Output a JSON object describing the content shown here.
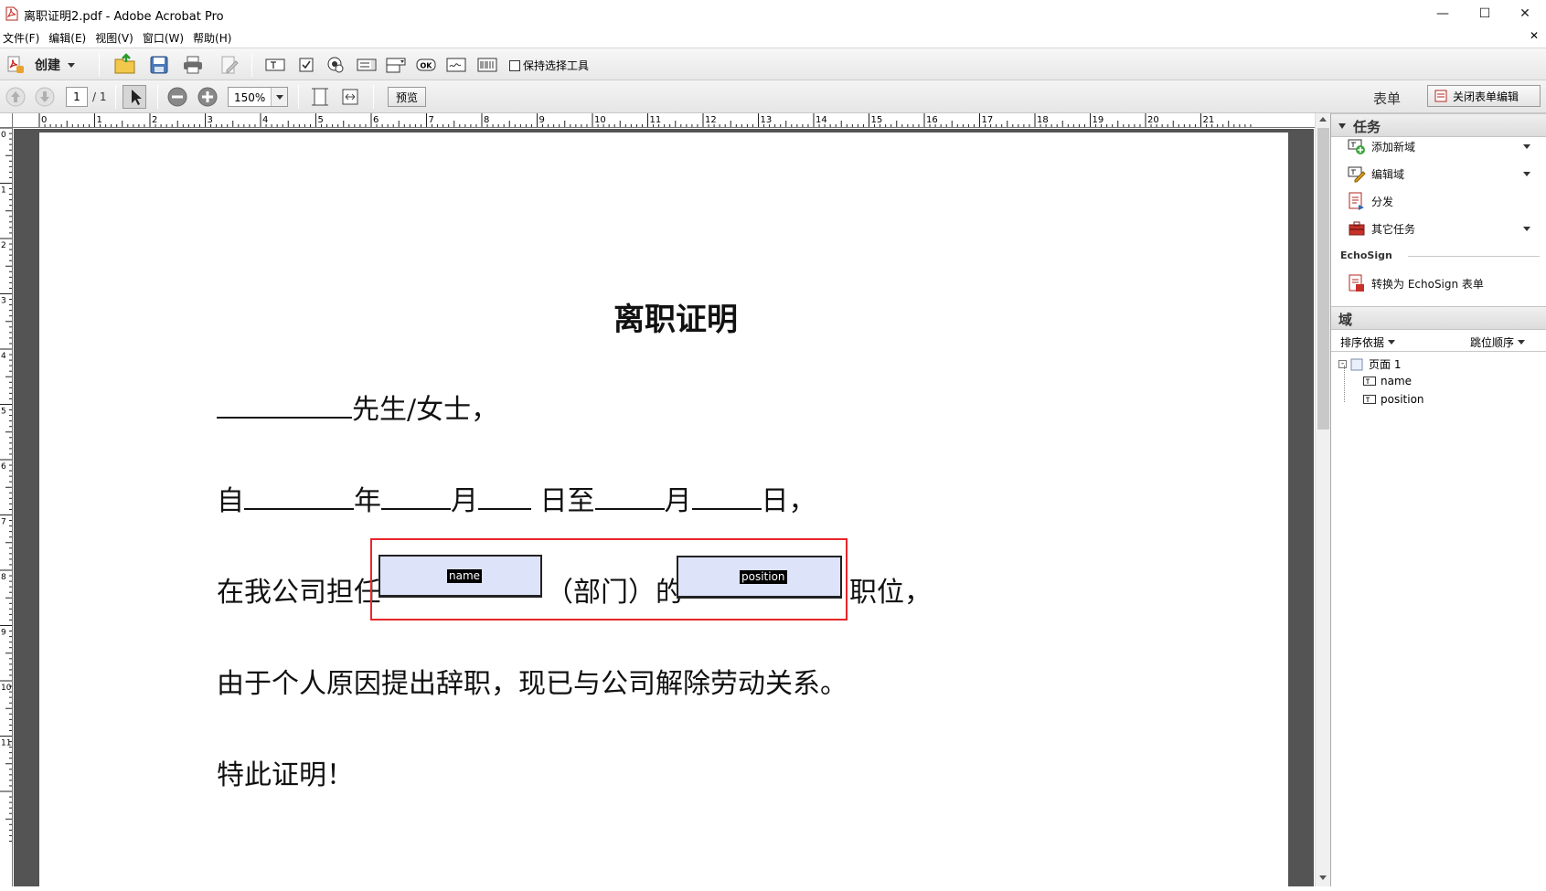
{
  "window": {
    "title": "离职证明2.pdf - Adobe Acrobat Pro",
    "minimize": "—",
    "maximize": "☐",
    "close": "✕"
  },
  "menu": {
    "items": [
      "文件(F)",
      "编辑(E)",
      "视图(V)",
      "窗口(W)",
      "帮助(H)"
    ],
    "close_doc": "✕"
  },
  "toolbar1": {
    "create_label": "创建",
    "keep_tool_label": "保持选择工具"
  },
  "toolbar2": {
    "page_current": "1",
    "page_total": "/ 1",
    "zoom": "150%",
    "preview_label": "预览",
    "form_label": "表单",
    "close_form_label": "关闭表单编辑"
  },
  "ruler": {
    "top_marks": [
      "0",
      "1",
      "2",
      "3",
      "4",
      "5",
      "6",
      "7",
      "8",
      "9",
      "10",
      "11",
      "12",
      "13",
      "14",
      "15",
      "16",
      "17",
      "18",
      "19",
      "20",
      "21"
    ],
    "left_marks": [
      "0",
      "1",
      "2",
      "3",
      "4",
      "5",
      "6",
      "7",
      "8",
      "9",
      "10",
      "11"
    ]
  },
  "document": {
    "title": "离职证明",
    "line1_suffix": "先生/女士，",
    "line2": {
      "p1": "自",
      "p2": "年",
      "p3": "月",
      "p4": " 日至",
      "p5": "月",
      "p6": "日，"
    },
    "line3": {
      "prefix": "在我公司担任",
      "middle": "（部门）的",
      "suffix": "职位，"
    },
    "line4": "由于个人原因提出辞职，现已与公司解除劳动关系。",
    "line5": "特此证明！",
    "fields": [
      {
        "name": "name"
      },
      {
        "name": "position"
      }
    ]
  },
  "panel": {
    "tasks_header": "任务",
    "tasks": [
      {
        "label": "添加新域",
        "has_dropdown": true
      },
      {
        "label": "编辑域",
        "has_dropdown": true
      },
      {
        "label": "分发",
        "has_dropdown": false
      },
      {
        "label": "其它任务",
        "has_dropdown": true
      }
    ],
    "echosign_label": "EchoSign",
    "echosign_task": "转换为 EchoSign 表单",
    "fields_header": "域",
    "sort_label": "排序依据",
    "tab_order_label": "跳位顺序",
    "tree": {
      "page": "页面 1",
      "fields": [
        "name",
        "position"
      ]
    }
  },
  "colors": {
    "selection_red": "#e8262a",
    "field_fill": "#dde3f9",
    "doc_bg": "#545454"
  }
}
